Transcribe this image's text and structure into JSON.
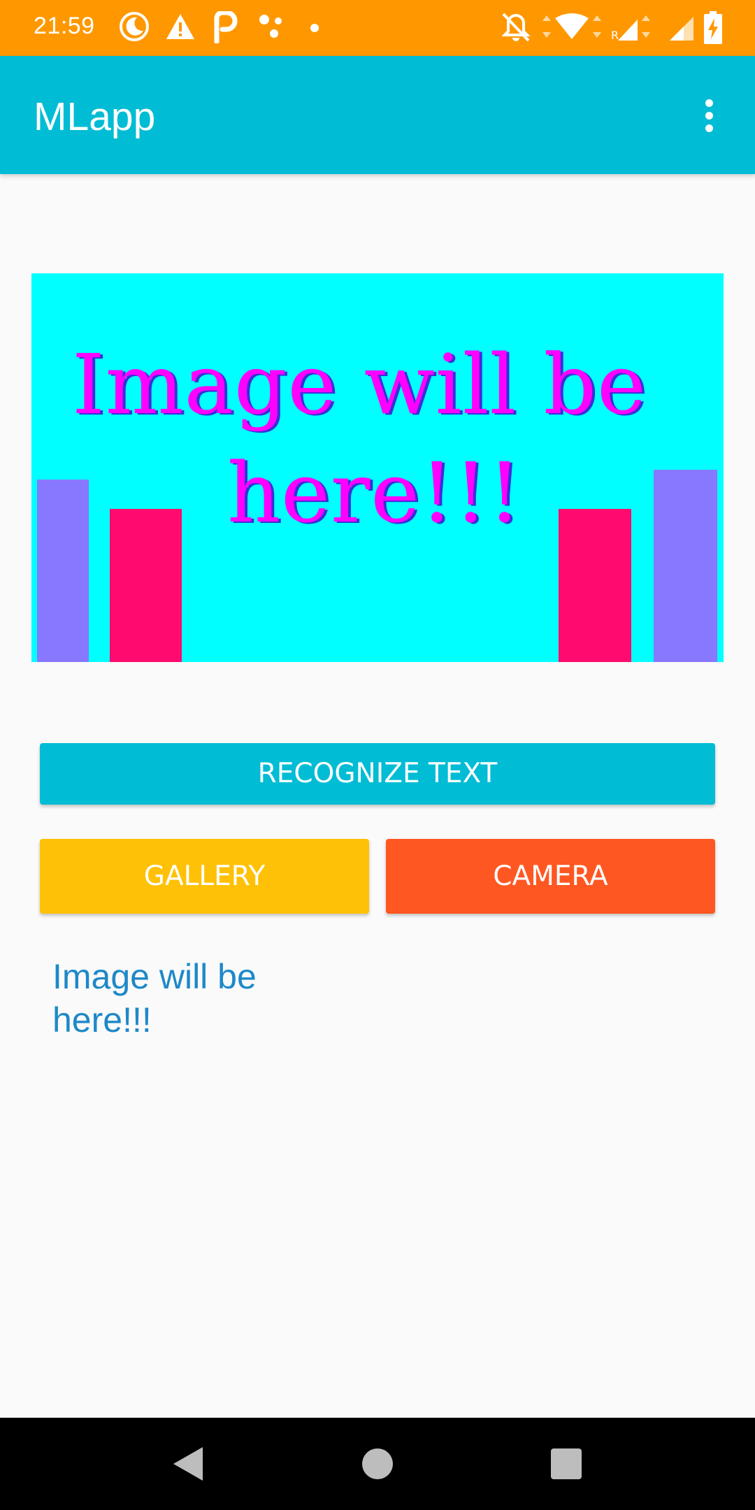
{
  "status_bar": {
    "time": "21:59",
    "background": "#ff9800",
    "icons": [
      "moon-icon",
      "warning-icon",
      "parking-icon",
      "dots-icon",
      "dot-icon",
      "bell-off-icon",
      "wifi-icon",
      "signal-roaming-icon",
      "signal-icon",
      "battery-charging-icon"
    ]
  },
  "app_bar": {
    "title": "MLapp",
    "background": "#00bcd4",
    "menu_icon": "more-vert-icon"
  },
  "preview": {
    "line1": "Image will be",
    "line2": "here!!!",
    "background": "#00ffff",
    "text_color": "#ff00ff",
    "bar_colors": [
      "#8877ff",
      "#ff0a6e"
    ]
  },
  "buttons": {
    "recognize_label": "RECOGNIZE TEXT",
    "gallery_label": "GALLERY",
    "camera_label": "CAMERA"
  },
  "result": {
    "text": "Image will be here!!!"
  },
  "nav_bar": {
    "icons": [
      "back-icon",
      "home-icon",
      "recents-icon"
    ]
  }
}
